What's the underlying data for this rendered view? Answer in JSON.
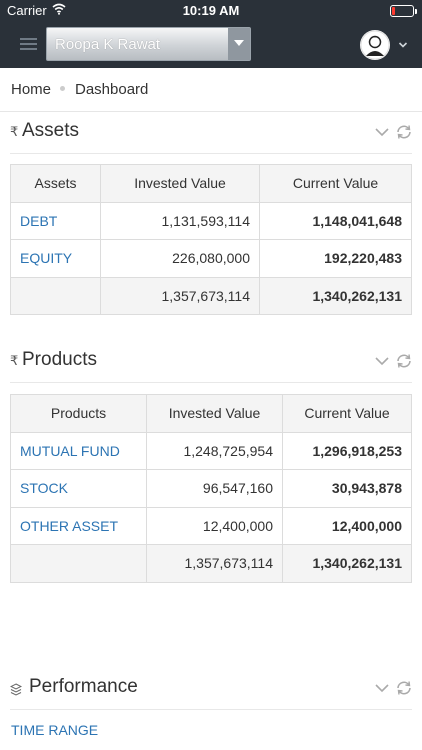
{
  "status": {
    "carrier": "Carrier",
    "time": "10:19 AM"
  },
  "nav": {
    "user": "Roopa K Rawat"
  },
  "breadcrumb": {
    "home": "Home",
    "current": "Dashboard"
  },
  "assets": {
    "symbol": "₹",
    "title": "Assets",
    "headers": [
      "Assets",
      "Invested Value",
      "Current Value"
    ],
    "rows": [
      {
        "name": "DEBT",
        "invested": "1,131,593,114",
        "current": "1,148,041,648"
      },
      {
        "name": "EQUITY",
        "invested": "226,080,000",
        "current": "192,220,483"
      }
    ],
    "total": {
      "name": "",
      "invested": "1,357,673,114",
      "current": "1,340,262,131"
    }
  },
  "products": {
    "symbol": "₹",
    "title": "Products",
    "headers": [
      "Products",
      "Invested Value",
      "Current Value"
    ],
    "rows": [
      {
        "name": "MUTUAL FUND",
        "invested": "1,248,725,954",
        "current": "1,296,918,253"
      },
      {
        "name": "STOCK",
        "invested": "96,547,160",
        "current": "30,943,878"
      },
      {
        "name": "OTHER ASSET",
        "invested": "12,400,000",
        "current": "12,400,000"
      }
    ],
    "total": {
      "name": "",
      "invested": "1,357,673,114",
      "current": "1,340,262,131"
    }
  },
  "performance": {
    "title": "Performance",
    "time_range_label": "TIME RANGE"
  }
}
